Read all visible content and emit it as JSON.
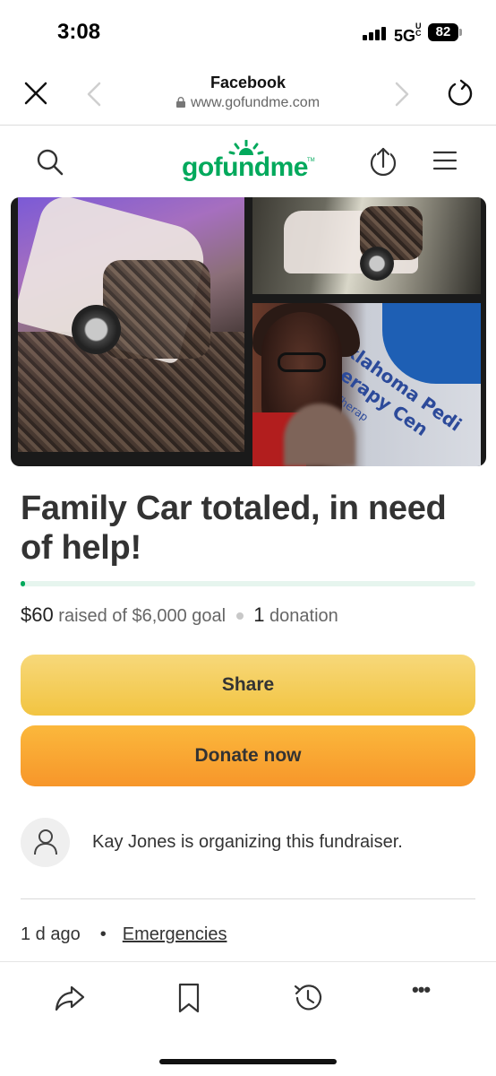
{
  "status_bar": {
    "time": "3:08",
    "network": "5G",
    "network_suffix": "UC",
    "battery": "82"
  },
  "browser": {
    "title": "Facebook",
    "url": "www.gofundme.com"
  },
  "site": {
    "logo_text": "gofundme",
    "logo_tm": "TM",
    "brand_color": "#02a95c"
  },
  "campaign": {
    "title": "Family Car totaled, in need of help!",
    "raised": "$60",
    "raised_text": "raised of $6,000 goal",
    "donation_count": "1",
    "donation_label": "donation",
    "progress_fraction": 0.01,
    "photo_sign_text": [
      "Oklahoma Pedi",
      "Therapy Cen",
      "vioral Therap"
    ]
  },
  "actions": {
    "share_label": "Share",
    "donate_label": "Donate now"
  },
  "organizer": {
    "text": "Kay Jones is organizing this fundraiser."
  },
  "meta": {
    "age": "1 d ago",
    "bullet": "•",
    "category": "Emergencies"
  },
  "toolbar": {
    "icons": [
      "share-arrow-icon",
      "bookmark-icon",
      "history-icon",
      "more-icon"
    ],
    "more_label": "•••"
  }
}
